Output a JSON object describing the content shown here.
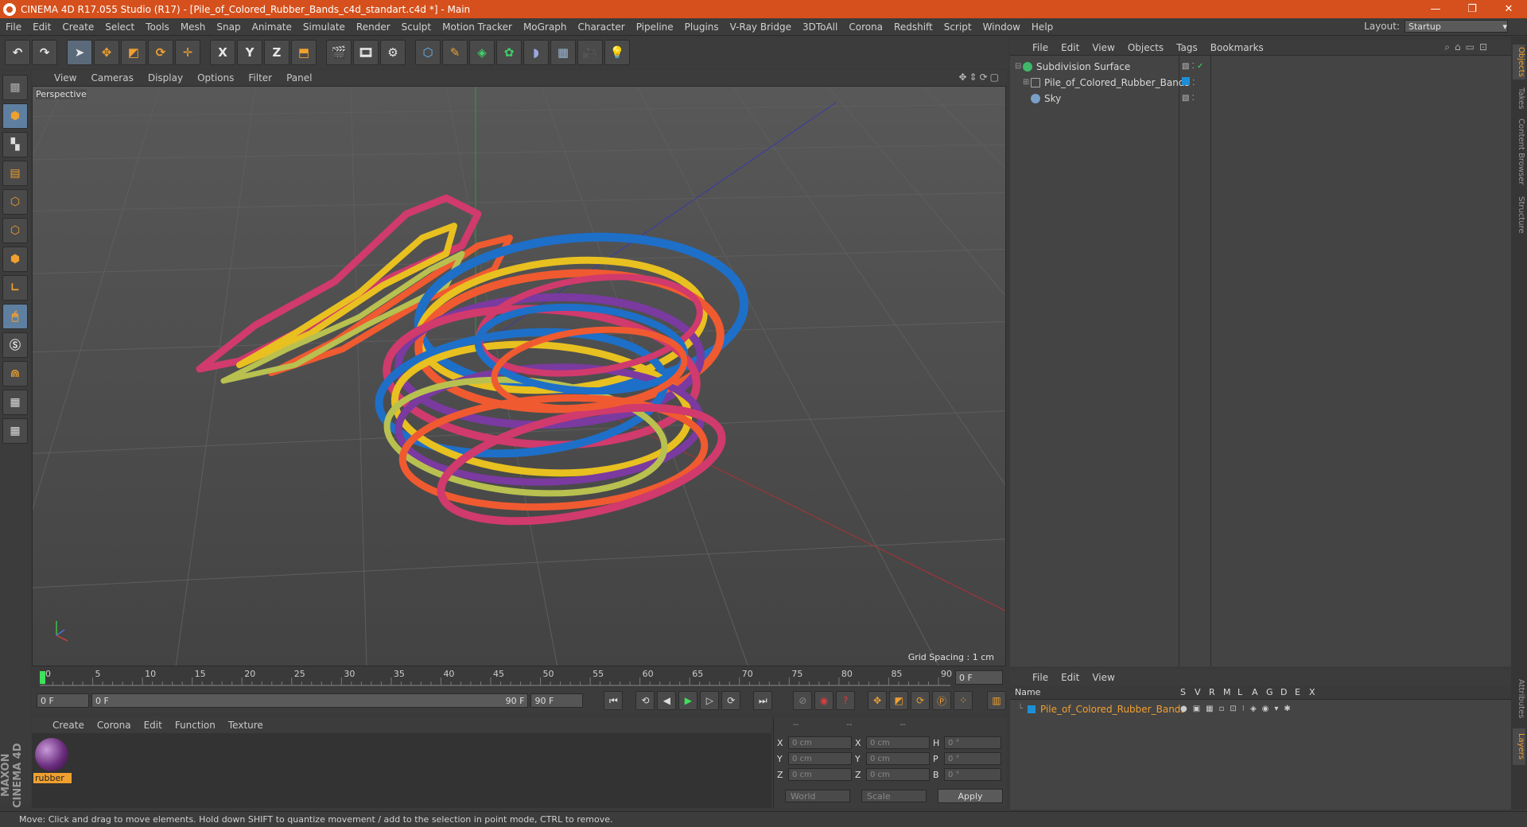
{
  "window": {
    "title": "CINEMA 4D R17.055 Studio (R17) - [Pile_of_Colored_Rubber_Bands_c4d_standart.c4d *] - Main",
    "minimize": "—",
    "maximize": "❐",
    "close": "✕"
  },
  "menubar": {
    "items": [
      "File",
      "Edit",
      "Create",
      "Select",
      "Tools",
      "Mesh",
      "Snap",
      "Animate",
      "Simulate",
      "Render",
      "Sculpt",
      "Motion Tracker",
      "MoGraph",
      "Character",
      "Pipeline",
      "Plugins",
      "V-Ray Bridge",
      "3DToAll",
      "Corona",
      "Redshift",
      "Script",
      "Window",
      "Help"
    ],
    "layout_label": "Layout:",
    "layout_value": "Startup"
  },
  "toolbar": {
    "undo_icon": "↶",
    "x_axis": "X",
    "y_axis": "Y",
    "z_axis": "Z"
  },
  "viewport": {
    "menu": [
      "View",
      "Cameras",
      "Display",
      "Options",
      "Filter",
      "Panel"
    ],
    "label": "Perspective",
    "grid_spacing": "Grid Spacing : 1 cm",
    "nav_icons": "✥⇕⟳▢"
  },
  "timeline": {
    "ticks": [
      "0",
      "5",
      "10",
      "15",
      "20",
      "25",
      "30",
      "35",
      "40",
      "45",
      "50",
      "55",
      "60",
      "65",
      "70",
      "75",
      "80",
      "85",
      "90"
    ],
    "current_frame": "0 F"
  },
  "transport": {
    "start": "0 F",
    "range_start": "0 F",
    "range_end": "90 F",
    "end": "90 F"
  },
  "material_manager": {
    "menu": [
      "Create",
      "Corona",
      "Edit",
      "Function",
      "Texture"
    ],
    "material_name": "rubber"
  },
  "coordinates": {
    "headers": [
      "--",
      "--",
      "--"
    ],
    "rows": [
      {
        "a": "X",
        "av": "0 cm",
        "b": "X",
        "bv": "0 cm",
        "c": "H",
        "cv": "0 °"
      },
      {
        "a": "Y",
        "av": "0 cm",
        "b": "Y",
        "bv": "0 cm",
        "c": "P",
        "cv": "0 °"
      },
      {
        "a": "Z",
        "av": "0 cm",
        "b": "Z",
        "bv": "0 cm",
        "c": "B",
        "cv": "0 °"
      }
    ],
    "world": "World",
    "scale": "Scale",
    "apply": "Apply"
  },
  "object_manager": {
    "menu": [
      "File",
      "Edit",
      "View",
      "Objects",
      "Tags",
      "Bookmarks"
    ],
    "objects": [
      {
        "name": "Subdivision Surface",
        "color": "#3fb86a"
      },
      {
        "name": "Pile_of_Colored_Rubber_Bands",
        "color": "#aaaaaa"
      },
      {
        "name": "Sky",
        "color": "#7aa0c8"
      }
    ]
  },
  "layer_manager": {
    "menu": [
      "File",
      "Edit",
      "View"
    ],
    "columns": [
      "Name",
      "S",
      "V",
      "R",
      "M",
      "L",
      "A",
      "G",
      "D",
      "E",
      "X"
    ],
    "layer_name": "Pile_of_Colored_Rubber_Bands",
    "layer_color": "#1e8fd6"
  },
  "right_tabs": [
    "Objects",
    "Takes",
    "Content Browser",
    "Structure",
    "Attributes",
    "Layers"
  ],
  "status": {
    "text": "Move: Click and drag to move elements. Hold down SHIFT to quantize movement / add to the selection in point mode, CTRL to remove."
  },
  "brand": {
    "logo_text": "MAXON CINEMA 4D"
  }
}
